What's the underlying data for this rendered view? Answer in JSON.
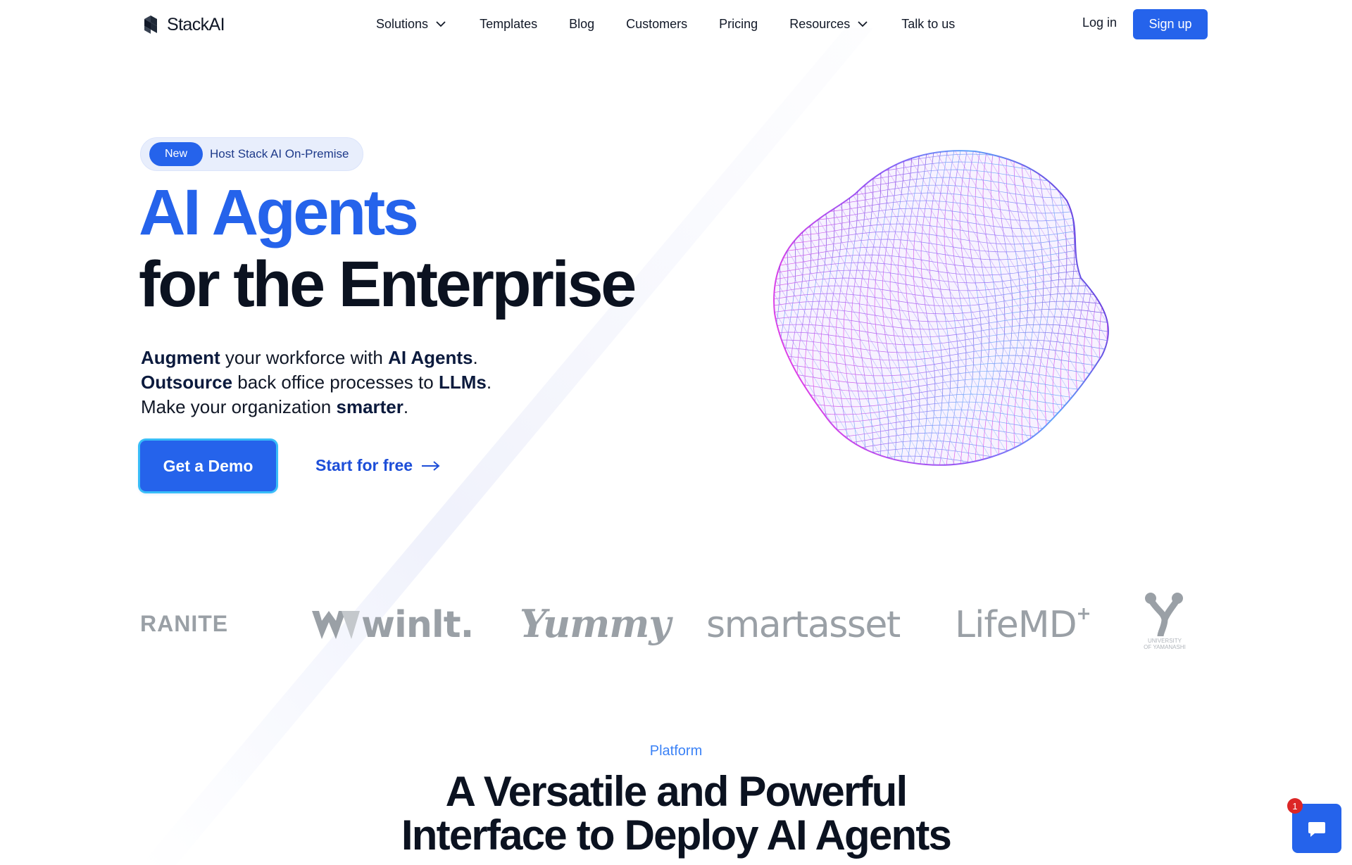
{
  "brand": {
    "name": "StackAI",
    "accent": "#2563eb"
  },
  "nav": {
    "items": [
      {
        "label": "Solutions",
        "has_dropdown": true
      },
      {
        "label": "Templates",
        "has_dropdown": false
      },
      {
        "label": "Blog",
        "has_dropdown": false
      },
      {
        "label": "Customers",
        "has_dropdown": false
      },
      {
        "label": "Pricing",
        "has_dropdown": false
      },
      {
        "label": "Resources",
        "has_dropdown": true
      },
      {
        "label": "Talk to us",
        "has_dropdown": false
      }
    ],
    "login_label": "Log in",
    "signup_label": "Sign up"
  },
  "hero": {
    "badge_pill": "New",
    "badge_text": "Host Stack AI On-Premise",
    "title_line1": "AI Agents",
    "title_line2": "for the Enterprise",
    "sub": {
      "l1_b1": "Augment",
      "l1_t1": " your workforce with ",
      "l1_b2": "AI Agents",
      "l1_t2": ".",
      "l2_b1": "Outsource",
      "l2_t1": " back office processes to ",
      "l2_b2": "LLMs",
      "l2_t2": ".",
      "l3_t1": "Make your organization ",
      "l3_b1": "smarter",
      "l3_t2": "."
    },
    "demo_label": "Get a Demo",
    "start_label": "Start for free"
  },
  "logos": {
    "granite": "RANITE",
    "winit": "winlt.",
    "yummy": "Yummy",
    "smartasset": "smartasset",
    "lifemd": "LifeMD",
    "yamanashi": "UNIVERSITY OF YAMANASHI"
  },
  "platform": {
    "eyebrow": "Platform",
    "title_line1": "A Versatile and Powerful",
    "title_line2": "Interface to Deploy AI Agents"
  },
  "chat": {
    "badge_count": "1"
  }
}
